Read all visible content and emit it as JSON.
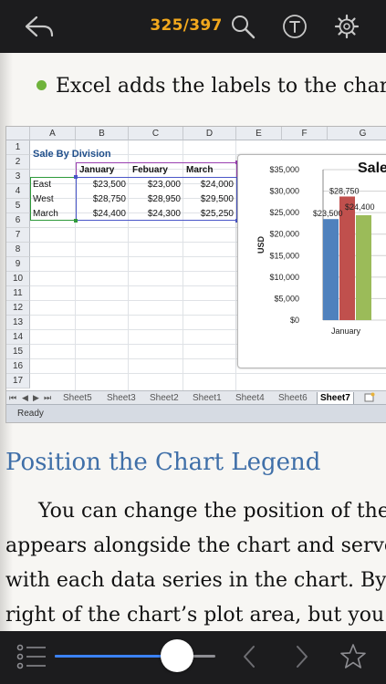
{
  "toolbar": {
    "page_indicator": "325/397",
    "back_icon": "return-arrow-icon",
    "search_icon": "search-icon",
    "font_icon": "text-format-icon",
    "settings_icon": "gear-icon"
  },
  "content": {
    "bullet_text": "Excel adds the labels to the chart.",
    "heading": "Position the Chart Legend",
    "body_lines": [
      "You can change the position of the",
      "appears alongside the chart and serve",
      "with each data series in the chart. By d",
      "right of the chart’s plot area, but you m"
    ]
  },
  "spreadsheet": {
    "columns": [
      "A",
      "B",
      "C",
      "D",
      "E",
      "F",
      "G"
    ],
    "rows": [
      "1",
      "2",
      "3",
      "4",
      "5",
      "6",
      "7",
      "8",
      "9",
      "10",
      "11",
      "12",
      "13",
      "14",
      "15",
      "16",
      "17"
    ],
    "title": "Sale By Division",
    "headers": [
      "January",
      "Febuary",
      "March"
    ],
    "data": [
      {
        "label": "East",
        "values": [
          "$23,500",
          "$23,000",
          "$24,000"
        ]
      },
      {
        "label": "West",
        "values": [
          "$28,750",
          "$28,950",
          "$29,500"
        ]
      },
      {
        "label": "March",
        "values": [
          "$24,400",
          "$24,300",
          "$25,250"
        ]
      }
    ],
    "sheet_tabs": [
      "Sheet5",
      "Sheet3",
      "Sheet2",
      "Sheet1",
      "Sheet4",
      "Sheet6",
      "Sheet7"
    ],
    "active_tab": "Sheet7",
    "status": "Ready"
  },
  "chart_data": {
    "type": "bar",
    "title": "Sale",
    "ylabel": "USD",
    "categories": [
      "January"
    ],
    "series": [
      {
        "values": [
          23500
        ],
        "color": "#4f81bd"
      },
      {
        "values": [
          28750
        ],
        "color": "#c0504d"
      },
      {
        "values": [
          24400
        ],
        "color": "#9bbb59"
      }
    ],
    "data_labels": [
      "$23,500",
      "$28,750",
      "$24,400"
    ],
    "yticks": [
      "$35,000",
      "$30,000",
      "$25,000",
      "$20,000",
      "$15,000",
      "$10,000",
      "$5,000",
      "$0"
    ],
    "ylim": [
      0,
      35000
    ],
    "grid": true
  },
  "reader_controls": {
    "toc_icon": "list-icon",
    "progress": 0.76,
    "prev_icon": "chevron-left-icon",
    "next_icon": "chevron-right-icon",
    "bookmark_icon": "star-icon"
  }
}
